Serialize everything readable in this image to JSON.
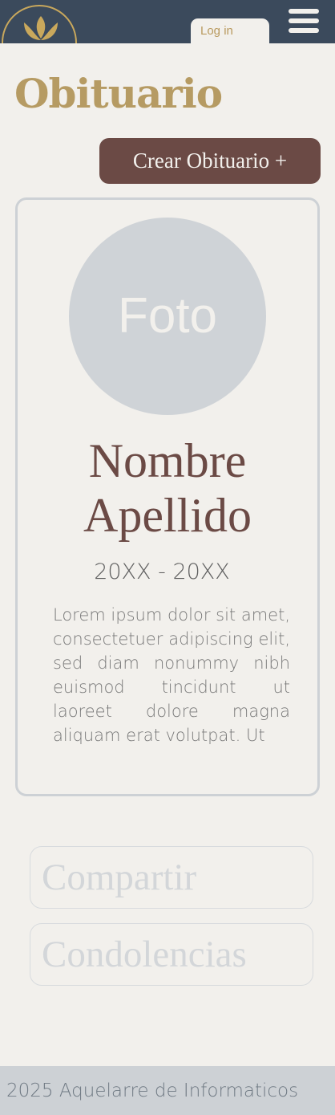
{
  "header": {
    "logo_icon": "lotus-icon",
    "login_label": "Log in",
    "menu_icon": "hamburger-menu-icon"
  },
  "page": {
    "title": "Obituario",
    "create_button_label": "Crear Obituario +"
  },
  "card": {
    "photo_label": "Foto",
    "first_name": "Nombre",
    "last_name": "Apellido",
    "dates": "20XX - 20XX",
    "bio": "Lorem ipsum dolor sit amet, consectetuer adipiscing elit, sed diam nonummy nibh euismod tincidunt ut laoreet dolore magna aliquam erat volutpat. Ut"
  },
  "actions": {
    "share_label": "Compartir",
    "condolences_label": "Condolencias"
  },
  "footer": {
    "text": "2025 Aquelarre de Informaticos"
  },
  "colors": {
    "header_bg": "#3b4a5c",
    "page_bg": "#f2f0ec",
    "gold": "#b69b63",
    "brown": "#6b4a45",
    "gray": "#cdd1d5"
  }
}
